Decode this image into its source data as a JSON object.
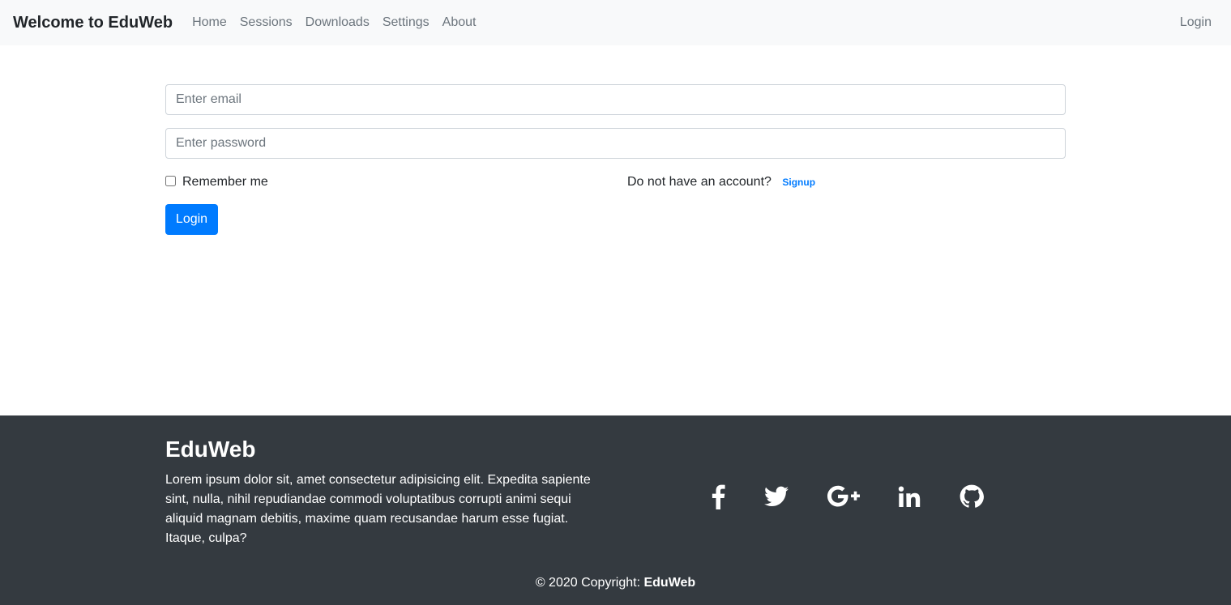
{
  "navbar": {
    "brand": "Welcome to EduWeb",
    "links": [
      "Home",
      "Sessions",
      "Downloads",
      "Settings",
      "About"
    ],
    "login": "Login"
  },
  "form": {
    "email_placeholder": "Enter email",
    "password_placeholder": "Enter password",
    "remember_label": "Remember me",
    "no_account_text": "Do not have an account?",
    "signup_link": "Signup",
    "login_button": "Login"
  },
  "footer": {
    "title": "EduWeb",
    "text": "Lorem ipsum dolor sit, amet consectetur adipisicing elit. Expedita sapiente sint, nulla, nihil repudiandae commodi voluptatibus corrupti animi sequi aliquid magnam debitis, maxime quam recusandae harum esse fugiat. Itaque, culpa?",
    "social_icons": [
      "facebook-icon",
      "twitter-icon",
      "google-plus-icon",
      "linkedin-icon",
      "github-icon"
    ],
    "copyright_prefix": "© 2020 Copyright:",
    "copyright_brand": "EduWeb"
  },
  "colors": {
    "navbar_bg": "#f8f9fa",
    "primary": "#007bff",
    "footer_bg": "#343a40"
  }
}
